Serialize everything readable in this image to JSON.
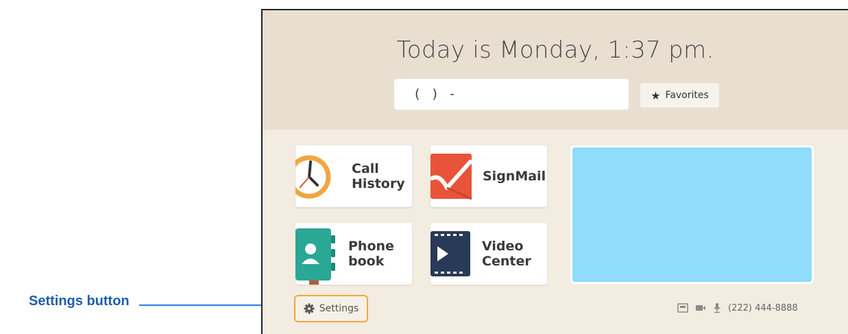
{
  "callout": {
    "label": "Settings button"
  },
  "header": {
    "title": "Today is Monday, 1:37 pm.",
    "dial_value": "(   )   -",
    "favorites_label": "Favorites"
  },
  "tiles": [
    {
      "id": "call-history",
      "line1": "Call",
      "line2": "History",
      "icon": "clock-icon"
    },
    {
      "id": "signmail",
      "line1": "SignMail",
      "line2": "",
      "icon": "signmail-icon"
    },
    {
      "id": "phonebook",
      "line1": "Phone",
      "line2": "book",
      "icon": "phonebook-icon"
    },
    {
      "id": "video-center",
      "line1": "Video",
      "line2": "Center",
      "icon": "film-play-icon"
    }
  ],
  "footer": {
    "settings_label": "Settings",
    "phone_number": "(222) 444-8888",
    "status_icons": [
      "network-icon",
      "camera-icon",
      "microphone-icon"
    ]
  },
  "colors": {
    "accent_orange": "#f0a640",
    "preview_blue": "#8fdcfb",
    "signmail_red": "#e8543a",
    "phonebook_teal": "#2aa795",
    "video_navy": "#283a57",
    "callout_blue": "#1f5fa8"
  }
}
